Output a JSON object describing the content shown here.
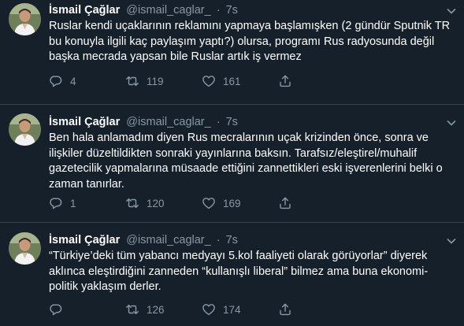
{
  "colors": {
    "background": "#15202b",
    "muted": "#8899a6",
    "divider": "#38444d",
    "text": "#ffffff"
  },
  "icons": {
    "reply": "speech-bubble",
    "retweet": "retweet-arrows",
    "like": "heart",
    "share": "share-arrow",
    "menu": "chevron-down"
  },
  "tweets": [
    {
      "name": "İsmail Çağlar",
      "handle": "@ismail_caglar_",
      "dot": "·",
      "time": "7s",
      "lines": [
        "Ruslar kendi uçaklarının reklamını yapmaya başlamışken (2 gündür Sputnik TR",
        "bu konuyla ilgili kaç paylaşım yaptı?) olursa, programı Rus radyosunda değil",
        "başka mecrada yapsan bile Ruslar artık iş vermez"
      ],
      "replies": "4",
      "retweets": "119",
      "likes": "161"
    },
    {
      "name": "İsmail Çağlar",
      "handle": "@ismail_caglar_",
      "dot": "·",
      "time": "7s",
      "lines": [
        "Ben hala anlamadım diyen Rus mecralarının uçak krizinden önce, sonra ve",
        "ilişkiler düzeltildikten sonraki yayınlarına baksın. Tarafsız/eleştirel/muhalif",
        "gazetecilik yapmalarına müsaade ettiğini zannettikleri eski işverenlerini belki o",
        "zaman tanırlar."
      ],
      "replies": "1",
      "retweets": "120",
      "likes": "169"
    },
    {
      "name": "İsmail Çağlar",
      "handle": "@ismail_caglar_",
      "dot": "·",
      "time": "7s",
      "lines": [
        "“Türkiye’deki tüm yabancı medyayı 5.kol faaliyeti olarak görüyorlar” diyerek",
        "aklınca eleştirdiğini zanneden “kullanışlı liberal” bilmez ama buna ekonomi-",
        "politik yaklaşım derler."
      ],
      "replies": "",
      "retweets": "126",
      "likes": "174"
    }
  ]
}
